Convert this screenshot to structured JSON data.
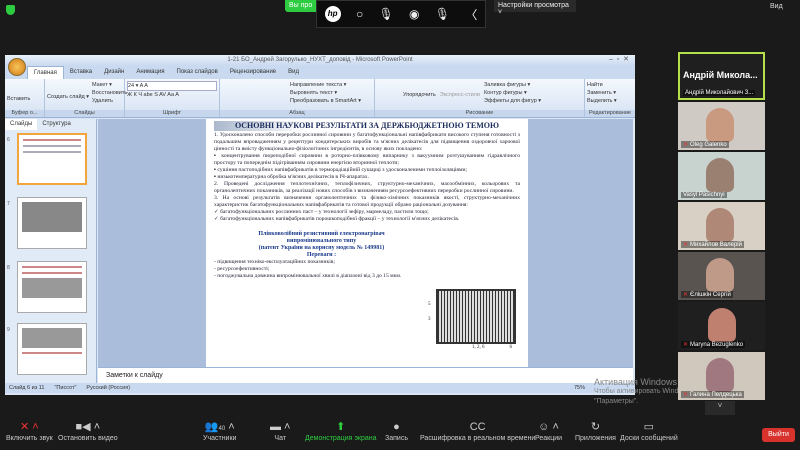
{
  "zoom": {
    "sharing_label": "Вы про",
    "view_settings": "Настройки просмотра ˅",
    "view": "Вид",
    "hp_logo": "hp",
    "hp_controls": [
      "○",
      "🎙",
      "◉",
      "🎙",
      "〈"
    ]
  },
  "ppt": {
    "title": "1-21 БО_Андрей Загорулько_НУХТ_доповід - Microsoft PowerPoint",
    "tabs": [
      "Главная",
      "Вставка",
      "Дизайн",
      "Анимация",
      "Показ слайдов",
      "Рецензирование",
      "Вид"
    ],
    "groups": [
      {
        "label": "Буфер о...",
        "items": [
          "Вставить"
        ]
      },
      {
        "label": "Слайды",
        "items": [
          "Макет ▾",
          "Восстановить",
          "Создать слайд ▾",
          "Удалить"
        ]
      },
      {
        "label": "Шрифт",
        "items": [
          "24 ▾  A A",
          "Ж К Ч abe S AV Aa A"
        ]
      },
      {
        "label": "Абзац",
        "items": [
          "Направление текста ▾",
          "Выровнять текст ▾",
          "Преобразовать в SmartArt ▾"
        ]
      },
      {
        "label": "Рисование",
        "items": [
          "Упорядочить",
          "Экспресс-стили",
          "Заливка фигуры ▾",
          "Контур фигуры ▾",
          "Эффекты для фигур ▾"
        ]
      },
      {
        "label": "Редактирование",
        "items": [
          "Найти",
          "Заменить ▾",
          "Выделить ▾"
        ]
      }
    ],
    "pane_tabs": [
      "Слайды",
      "Структура"
    ],
    "thumb_numbers": [
      "6",
      "7",
      "8",
      "9"
    ],
    "slide": {
      "heading": "ОСНОВНІ НАУКОВІ РЕЗУЛЬТАТИ ЗА ДЕРЖБЮДЖЕТНОЮ ТЕМОЮ",
      "p1": "1. Удосконалено способи переробки рослинної сировини у багатофункціональні напівфабрикати високого ступеня готовності з подальшим впровадженням у рецептури кондитерських виробів та м'ясних делікатесів для підвищення оздоровчої харчової цінності та вмісту функціонально-фізіологічних інгредієнтів, в основу яких покладено:",
      "b1": "▪  концентрування пюреподібної сировини в роторно-плівковому випарнику з вакуумним розтушуванням гідравлічного простору та попереднім підігріванням сировини енергією вторинної теплоти;",
      "b2": "▪  сушіння пастоподібних напівфабрикатів в терморадіаційній сушарці з удосконаленими теплоізоляціями;",
      "b3": "▪  низькотемпературна обробка м'ясних делікатесів в ІЧ-апаратах.",
      "p2": "2. Проведені дослідження теплотехнічних, теплофізичних, структурно-механічних, масообмінних, кольорових та органолептичних показників, за реалізації нових способів з визначенням ресурсоефективних переробки рослинної сировини.",
      "p3": "3. На основі результатів визначення органолептичних та фізико-хімічних показників якості, структурно-механічних характеристик багатофункціональних напівфабрикатів та готової продукції обрано раціональні дозування:",
      "c1": "✓  багатофункціональних рослинних паст – у технології зефіру, мармеладу, пастили тощо;",
      "c2": "✓  багатофункціональних напівфабрикатів порошкоподібної фракції – у технології м'ясних делікатесів.",
      "cap1": "Плівковолібний резистивний електронагрівач",
      "cap2": "випромінювального типу",
      "patent": "(патент України на корисну модель № 149981)",
      "adv_title": "Переваги :",
      "adv": [
        "- підвищення техніко-експлуатаційних показників;",
        "- ресурсоефективності;",
        "- погоджувальна довжина випромінювальної хвилі в діапазоні від 3 до 15 мкм."
      ],
      "fig_labels": [
        "5",
        "3",
        "1, 2, 6",
        "6"
      ]
    },
    "notes": "Заметки к слайду",
    "status": [
      "Слайд 6 из 11",
      "\"Писсот\"",
      "Русский (Россия)"
    ],
    "zoom_level": "75%"
  },
  "activation": {
    "line1": "Активация Windows",
    "line2": "Чтобы активировать Windows, перейдите в раздел",
    "line3": "\"Параметры\"."
  },
  "participants": [
    {
      "name": "Андрій Микола...",
      "sub": "Андрій Миколайович З..."
    },
    {
      "name": "Oleg Galenko"
    },
    {
      "name": "Vasyl Pasichnyi"
    },
    {
      "name": "Михайлов Валерій"
    },
    {
      "name": "Єлішкін Сергій"
    },
    {
      "name": "Maryna Bezuglenko"
    },
    {
      "name": "Галина Пелдецька"
    }
  ],
  "toolbar": {
    "unmute": "Включить звук",
    "stop_video": "Остановить видео",
    "participants": "Участники",
    "participants_count": "40",
    "chat": "Чат",
    "share": "Демонстрация экрана",
    "record": "Запись",
    "captions": "Расшифровка в реальном времени",
    "reactions": "Реакции",
    "apps": "Приложения",
    "whiteboards": "Доски сообщений",
    "leave": "Выйти"
  }
}
